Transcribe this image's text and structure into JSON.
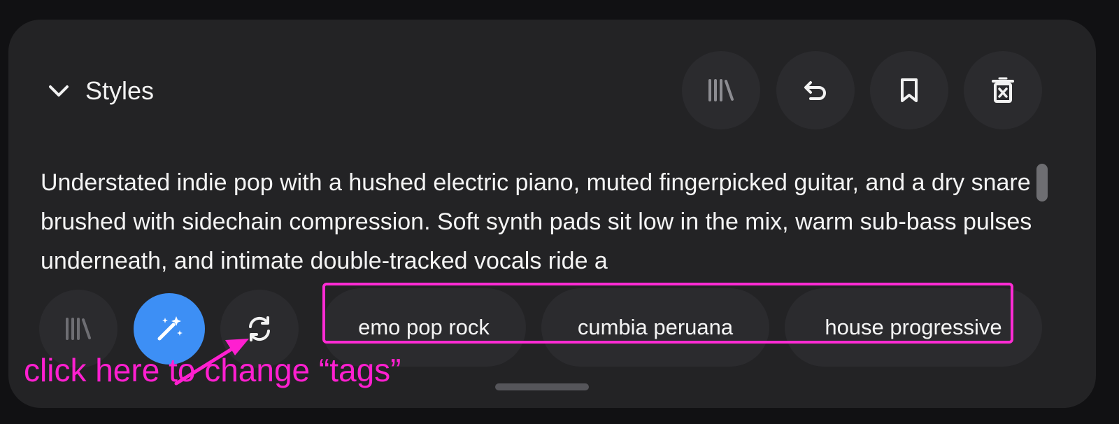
{
  "styles_panel": {
    "title": "Styles",
    "description": "Understated indie pop with a hushed electric piano, muted fingerpicked guitar, and a dry snare brushed with sidechain compression. Soft synth pads sit low in the mix, warm sub-bass pulses underneath, and intimate double-tracked vocals ride a",
    "header_icons": [
      "library-icon",
      "undo-icon",
      "bookmark-icon",
      "delete-icon"
    ],
    "footer_icons": [
      "library-icon",
      "magic-wand-icon",
      "refresh-icon"
    ],
    "tags": [
      "emo pop rock",
      "cumbia peruana",
      "house progressive"
    ]
  },
  "annotation": {
    "text": "click here to change “tags”",
    "color": "#ff1fd0"
  },
  "colors": {
    "background": "#111113",
    "panel": "#232325",
    "button": "#2b2b2e",
    "accent_blue": "#3d8ff5",
    "highlight": "#ff2bd4"
  }
}
